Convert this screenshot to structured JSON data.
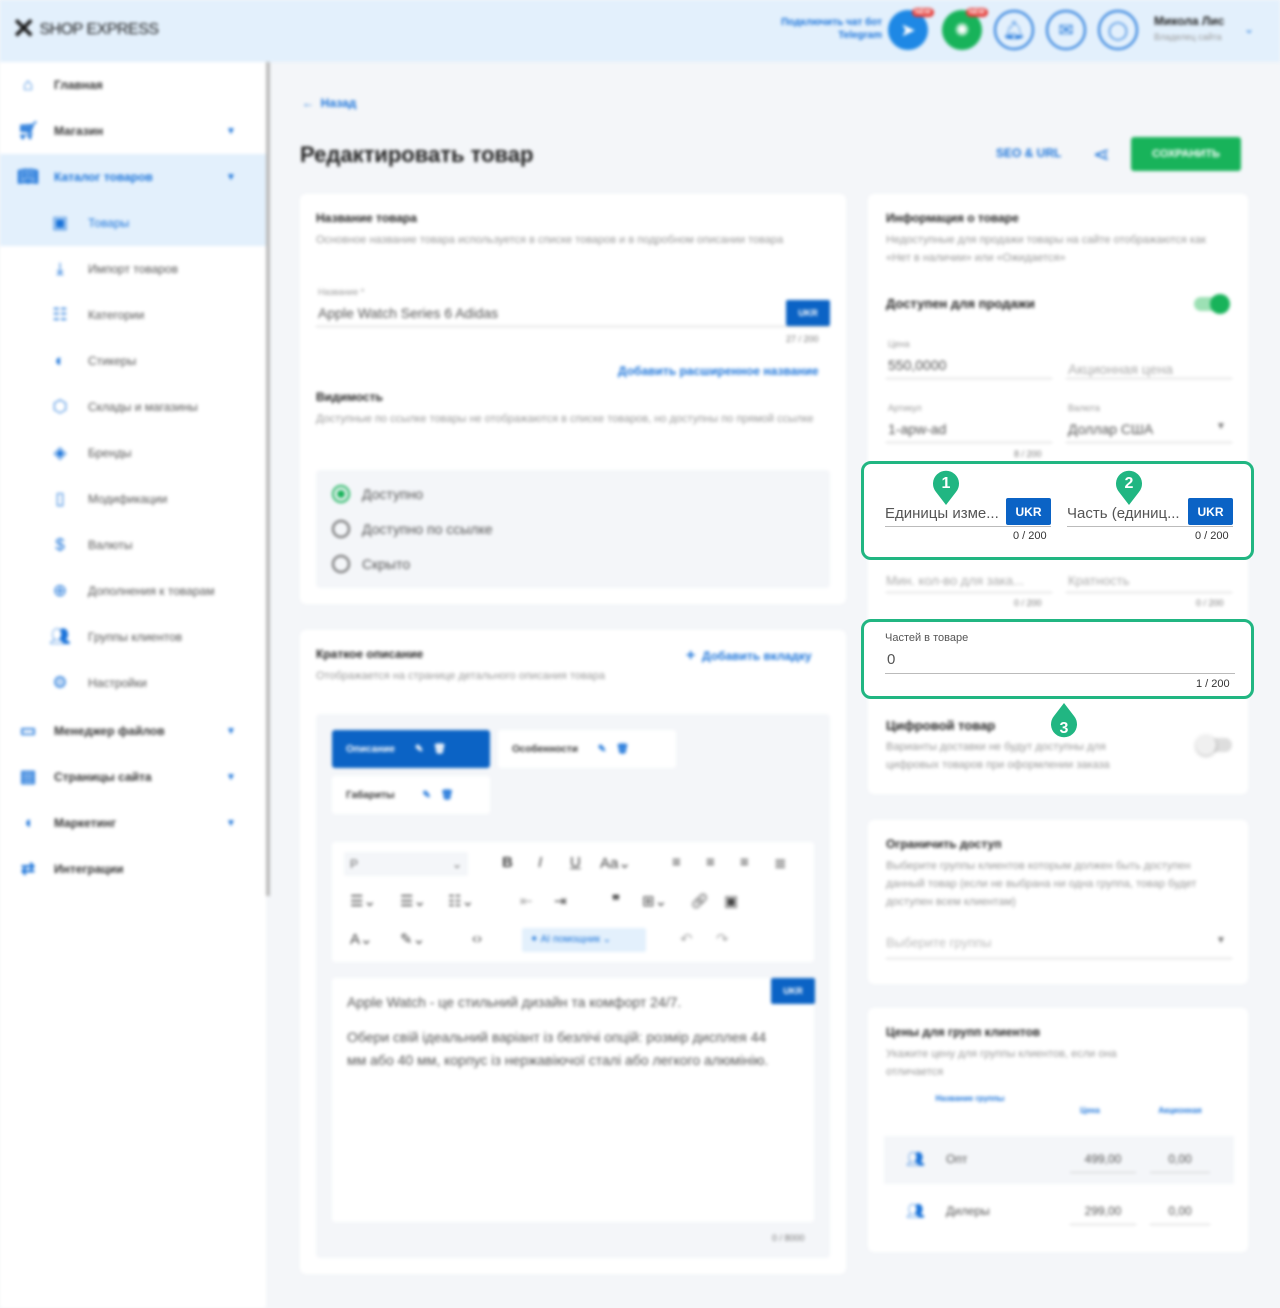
{
  "header": {
    "logo_text": "SHOP EXPRESS",
    "telegram_text": "Подключить чат бот Telegram",
    "new_badge_1": "NEW",
    "new_badge_2": "NEW",
    "user_name": "Микола Лис",
    "user_role": "Владелец сайта"
  },
  "sidebar": {
    "items": [
      {
        "label": "Главная",
        "icon": "home-icon"
      },
      {
        "label": "Магазин",
        "icon": "cart-icon"
      },
      {
        "label": "Каталог товаров",
        "icon": "book-icon"
      },
      {
        "label": "Товары",
        "icon": "box-icon"
      },
      {
        "label": "Импорт товаров",
        "icon": "download-icon"
      },
      {
        "label": "Категории",
        "icon": "list-icon"
      },
      {
        "label": "Стикеры",
        "icon": "sticker-icon"
      },
      {
        "label": "Склады и магазины",
        "icon": "warehouse-icon"
      },
      {
        "label": "Бренды",
        "icon": "tag-icon"
      },
      {
        "label": "Модификации",
        "icon": "bookmark-icon"
      },
      {
        "label": "Валюты",
        "icon": "dollar-icon"
      },
      {
        "label": "Дополнения к товарам",
        "icon": "plus-circle-icon"
      },
      {
        "label": "Группы клиентов",
        "icon": "users-icon"
      },
      {
        "label": "Настройки",
        "icon": "gear-icon"
      },
      {
        "label": "Менеджер файлов",
        "icon": "folder-icon"
      },
      {
        "label": "Страницы сайта",
        "icon": "pages-icon"
      },
      {
        "label": "Маркетинг",
        "icon": "megaphone-icon"
      },
      {
        "label": "Интеграции",
        "icon": "integration-icon"
      }
    ]
  },
  "page": {
    "back": "Назад",
    "title": "Редактировать товар",
    "seo": "SEO & URL",
    "save": "СОХРАНИТЬ"
  },
  "name_card": {
    "title": "Название товара",
    "desc": "Основное название товара используется в списке товаров и в подробном описании товара",
    "field_label": "Название *",
    "field_value": "Apple Watch Series 6 Adidas",
    "lang": "UKR",
    "counter": "27 / 200",
    "extended_link": "Добавить расширенное название",
    "visibility_title": "Видимость",
    "visibility_desc": "Доступные по ссылке товары не отображаются в списке товаров, но доступны по прямой ссылке",
    "radio": [
      "Доступно",
      "Доступно по ссылке",
      "Скрыто"
    ]
  },
  "short_desc": {
    "title": "Краткое описание",
    "desc": "Отображается на странице детального описания товара",
    "add_tab": "Добавить вкладку",
    "tabs": [
      "Описание",
      "Особенности",
      "Габариты"
    ],
    "format_select": "P",
    "font_size": "Aa",
    "ai_help": "AI помощник",
    "lang": "UKR",
    "text_1": "Apple Watch - це стильний дизайн та комфорт 24/7.",
    "text_2": "Обери свій ідеальний варіант із безлічі опцій: розмір дисплея 44 мм або 40 мм, корпус із нержавіючої сталі або легкого алюмінію.",
    "counter": "0 / 8000"
  },
  "info_card": {
    "title": "Информация о товаре",
    "desc": "Недоступные для продажи товары на сайте отображаются как «Нет в наличии» или «Ожидается»",
    "available": "Доступен для продажи",
    "available_on": true,
    "price_label": "Цена",
    "price": "550,0000",
    "promo_price": "Акционная цена",
    "sku_label": "Артикул",
    "sku": "1-apw-ad",
    "sku_counter": "8 / 200",
    "currency_label": "Валюта",
    "currency": "Доллар США",
    "units_placeholder": "Единицы изме...",
    "part_placeholder": "Часть (единиц...",
    "lang": "UKR",
    "units_counter": "0 / 200",
    "part_counter": "0 / 200",
    "min_qty": "Мин. кол-во для зака...",
    "multiplicity": "Кратность",
    "min_counter": "0 / 200",
    "mult_counter": "0 / 200",
    "parts_label": "Частей в товаре",
    "parts_value": "0",
    "parts_counter": "1 / 200",
    "digital_title": "Цифровой товар",
    "digital_desc": "Варианты доставки не будут доступны для цифровых товаров при оформлении заказа",
    "digital_on": false
  },
  "access_card": {
    "title": "Ограничить доступ",
    "desc": "Выберите группы клиентов которым должен быть доступен данный товар (если не выбрана ни одна группа, товар будет доступен всем клиентам)",
    "placeholder": "Выберите группы"
  },
  "group_prices": {
    "title": "Цены для групп клиентов",
    "desc": "Укажите цену для группы клиентов, если она отличается",
    "columns": [
      "Название группы",
      "Цена",
      "Акционная"
    ],
    "rows": [
      {
        "name": "Опт",
        "price": "499,00",
        "promo": "0,00"
      },
      {
        "name": "Дилеры",
        "price": "299,00",
        "promo": "0,00"
      }
    ]
  },
  "annotations": {
    "colors": {
      "highlight": "#21b682",
      "accent": "#1a73d9",
      "save": "#18b35a"
    },
    "markers": [
      "1",
      "2",
      "3"
    ]
  }
}
